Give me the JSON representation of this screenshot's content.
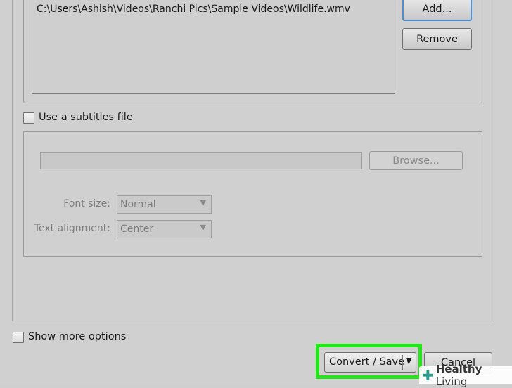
{
  "file_list": {
    "items": [
      "C:\\Users\\Ashish\\Videos\\Ranchi Pics\\Sample Videos\\Wildlife.wmv"
    ],
    "add_label": "Add...",
    "remove_label": "Remove"
  },
  "subtitles": {
    "checkbox_label": "Use a subtitles file",
    "checked": false,
    "file_value": "",
    "browse_label": "Browse...",
    "font_size_label": "Font size:",
    "font_size_value": "Normal",
    "text_alignment_label": "Text alignment:",
    "text_alignment_value": "Center"
  },
  "footer": {
    "show_more_label": "Show more options",
    "show_more_checked": false,
    "convert_label": "Convert / Save",
    "cancel_label": "Cancel",
    "highlight_color": "#27e31d"
  },
  "watermark": {
    "icon": "plus-icon",
    "text_bold": "Healthy",
    "text_regular": "Living"
  }
}
